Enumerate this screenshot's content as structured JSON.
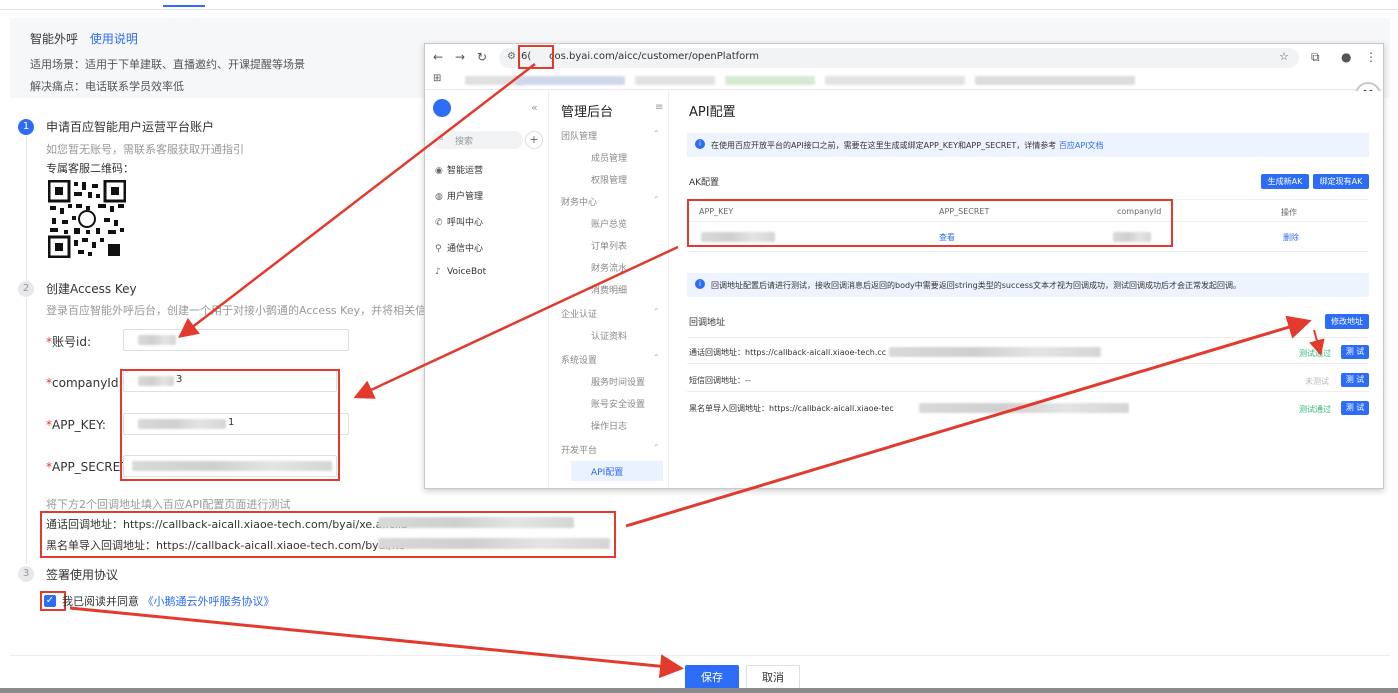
{
  "intro": {
    "title": "智能外呼",
    "help_link": "使用说明",
    "scenario": "适用场景：适用于下单建联、直播邀约、开课提醒等场景",
    "pain": "解决痛点：电话联系学员效率低"
  },
  "steps": [
    {
      "num": "1",
      "title": "申请百应智能用户运营平台账户",
      "hint": "如您暂无账号，需联系客服获取开通指引",
      "qr_label": "专属客服二维码："
    },
    {
      "num": "2",
      "title": "创建Access Key",
      "hint": "登录百应智能外呼后台，创建一个用于对接小鹅通的Access Key，并将相关信息填"
    },
    {
      "num": "3",
      "title": "签署使用协议"
    }
  ],
  "form": {
    "account_id_label": "账号id:",
    "company_id_label": "companyId:",
    "company_id_value_tail": "3",
    "app_key_label": "APP_KEY:",
    "app_key_value_tail": "1",
    "app_secret_label": "APP_SECRET:",
    "callback_hint": "将下方2个回调地址填入百应API配置页面进行测试",
    "call_callback": "通话回调地址：https://callback-aicall.xiaoe-tech.com/byai/xe.ai.cllb",
    "blacklist_callback": "黑名单导入回调地址：https://callback-aicall.xiaoe-tech.com/byai/xe"
  },
  "agree": {
    "checkbox": "✓",
    "text": "我已阅读并同意",
    "link": "《小鹅通云外呼服务协议》"
  },
  "footer": {
    "save": "保存",
    "cancel": "取消"
  },
  "browser": {
    "url_prefix": "6(",
    "url": "cos.byai.com/aicc/customer/openPlatform",
    "sidebar": {
      "search": "搜索",
      "items": [
        "智能运营",
        "用户管理",
        "呼叫中心",
        "通信中心",
        "VoiceBot"
      ]
    },
    "nav2": {
      "title": "管理后台",
      "groups": [
        {
          "name": "团队管理",
          "subs": [
            "成员管理",
            "权限管理"
          ]
        },
        {
          "name": "财务中心",
          "subs": [
            "账户总览",
            "订单列表",
            "财务流水",
            "消费明细"
          ]
        },
        {
          "name": "企业认证",
          "subs": [
            "认证资料"
          ]
        },
        {
          "name": "系统设置",
          "subs": [
            "服务时间设置",
            "账号安全设置",
            "操作日志"
          ]
        },
        {
          "name": "开发平台",
          "subs": [
            "API配置"
          ]
        }
      ]
    },
    "content": {
      "title": "API配置",
      "notice1": "在使用百应开放平台的API接口之前，需要在这里生成或绑定APP_KEY和APP_SECRET，详情参考",
      "notice1_link": "百应API文档",
      "ak_section": "AK配置",
      "gen_btn": "生成新AK",
      "bind_btn": "绑定现有AK",
      "th_app_key": "APP_KEY",
      "th_app_secret": "APP_SECRET",
      "th_company": "companyId",
      "th_ops": "操作",
      "view": "查看",
      "delete": "删除",
      "notice2": "回调地址配置后请进行测试，接收回调消息后返回的body中需要返回string类型的success文本才视为回调成功，测试回调成功后才会正常发起回调。",
      "cb_section": "回调地址",
      "edit_btn": "修改地址",
      "cb_rows": [
        {
          "label": "通话回调地址：https://callback-aicall.xiaoe-tech.cc",
          "status": "测试通过",
          "btn": "测 试"
        },
        {
          "label": "短信回调地址：--",
          "status": "未测试",
          "btn": "测 试"
        },
        {
          "label": "黑名单导入回调地址：https://callback-aicall.xiaoe-tec",
          "status": "测试通过",
          "btn": "测 试"
        }
      ]
    }
  }
}
